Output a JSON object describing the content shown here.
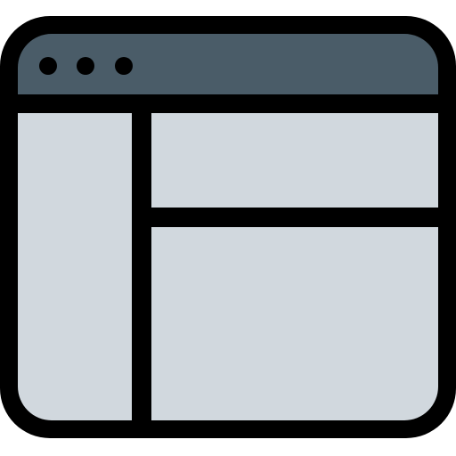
{
  "icon": {
    "name": "browser-window-layout-icon",
    "colors": {
      "outline": "#000000",
      "title_bar": "#4A5C68",
      "panel_fill": "#D1D8DE",
      "background": "#FFFFFF"
    },
    "title_bar": {
      "control_dots": 3
    },
    "panels": [
      {
        "name": "sidebar-panel"
      },
      {
        "name": "header-panel"
      },
      {
        "name": "content-panel"
      }
    ]
  }
}
